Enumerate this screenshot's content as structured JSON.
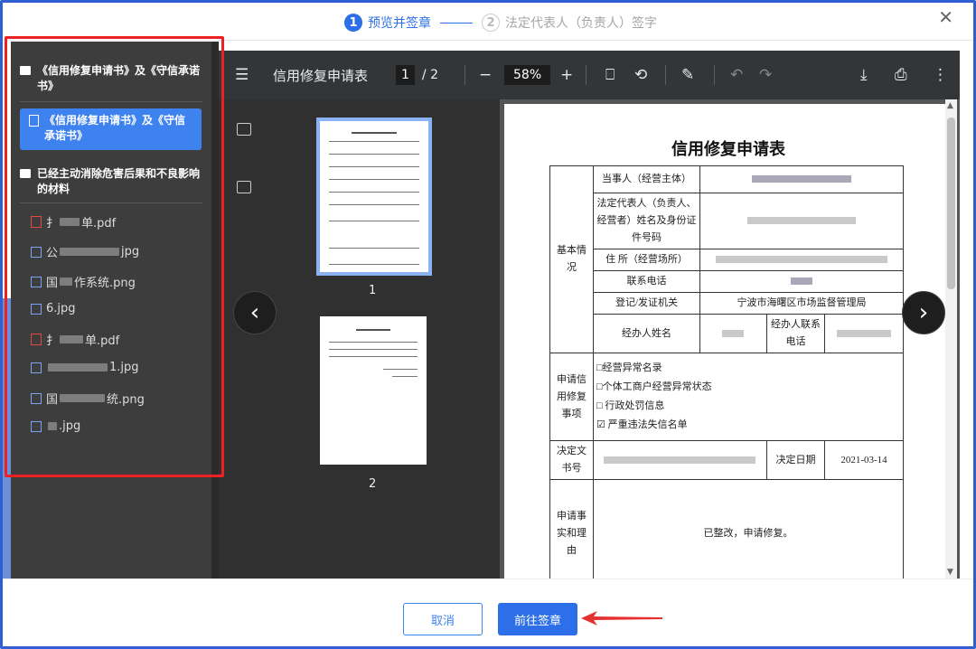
{
  "stepper": {
    "step1_num": "1",
    "step1_label": "预览并签章",
    "step2_num": "2",
    "step2_label": "法定代表人（负责人）签字"
  },
  "file_panel": {
    "group1_title": "《信用修复申请书》及《守信承诺书》",
    "active_item": "《信用修复申请书》及《守信承诺书》",
    "group2_title": "已经主动消除危害后果和不良影响的材料",
    "files": [
      {
        "prefix": "扌",
        "suffix": "单.pdf",
        "type": "pdf"
      },
      {
        "prefix": "公",
        "suffix": "jpg",
        "type": "image"
      },
      {
        "prefix": "国",
        "suffix": "作系统.png",
        "type": "image"
      },
      {
        "prefix": "",
        "suffix": "6.jpg",
        "type": "image"
      },
      {
        "prefix": "扌",
        "suffix": "单.pdf",
        "type": "pdf"
      },
      {
        "prefix": "",
        "suffix": "1.jpg",
        "type": "image"
      },
      {
        "prefix": "国",
        "suffix": "统.png",
        "type": "image"
      },
      {
        "prefix": "",
        "suffix": ".jpg",
        "type": "image"
      }
    ]
  },
  "viewer": {
    "doc_title": "信用修复申请表",
    "current_page": "1",
    "total_pages": "/ 2",
    "zoom": "58%",
    "thumb1_label": "1",
    "thumb2_label": "2"
  },
  "form": {
    "title": "信用修复申请表",
    "basic_info_label": "基本情况",
    "party_label": "当事人（经营主体）",
    "legal_rep_label": "法定代表人（负责人、经营者）姓名及身份证件号码",
    "address_label": "住  所（经营场所）",
    "phone_label": "联系电话",
    "authority_label": "登记/发证机关",
    "authority_value": "宁波市海曙区市场监督管理局",
    "agent_name_label": "经办人姓名",
    "agent_phone_label": "经办人联系电话",
    "apply_items_label": "申请信用修复事项",
    "option1": "□经营异常名录",
    "option2": "□个体工商户经营异常状态",
    "option3": "□ 行政处罚信息",
    "option4": "☑ 严重违法失信名单",
    "decision_no_label": "决定文书号",
    "decision_date_label": "决定日期",
    "decision_date_value": "2021-03-14",
    "reason_label": "申请事实和理由",
    "reason_value": "已整改，申请修复。"
  },
  "footer": {
    "cancel_label": "取消",
    "go_label": "前往签章"
  },
  "colors": {
    "accent": "#2d6fe8",
    "highlight_box": "#ee2121",
    "panel_bg": "#3d3d3d",
    "toolbar_bg": "#323639"
  }
}
